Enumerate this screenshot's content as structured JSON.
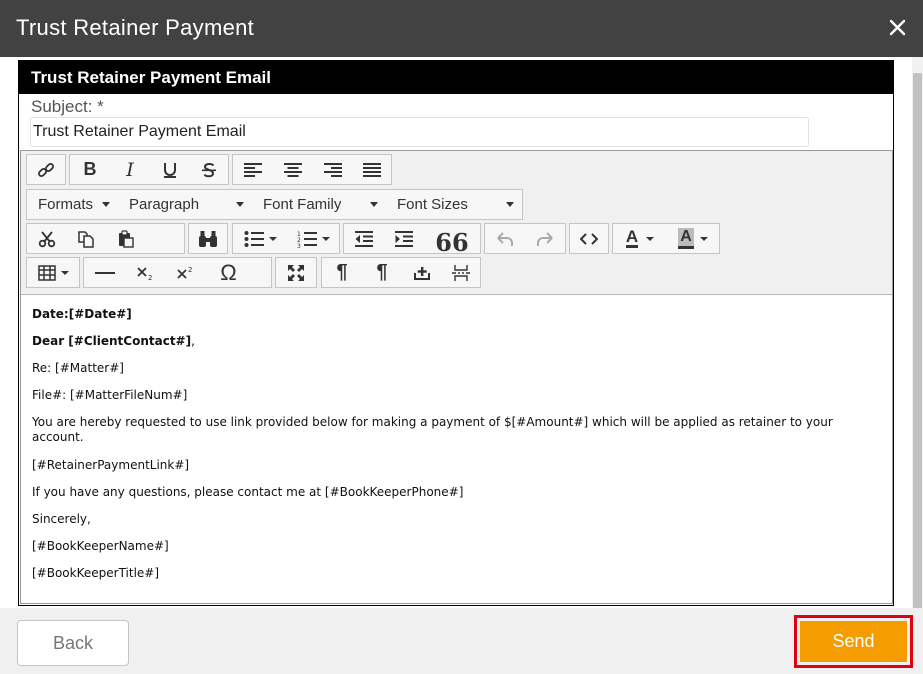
{
  "dialog": {
    "title": "Trust Retainer Payment",
    "close_icon": "close-icon"
  },
  "panel": {
    "header": "Trust Retainer Payment Email",
    "subject_label": "Subject: *",
    "subject_value": "Trust Retainer Payment Email"
  },
  "toolbar": {
    "row1_icons": [
      "link-icon",
      "bold-icon",
      "italic-icon",
      "underline-icon",
      "strikethrough-icon",
      "align-left-icon",
      "align-center-icon",
      "align-right-icon",
      "align-justify-icon"
    ],
    "formats_label": "Formats",
    "paragraph_label": "Paragraph",
    "font_family_label": "Font Family",
    "font_sizes_label": "Font Sizes",
    "row3_icons": [
      "cut-icon",
      "copy-icon",
      "paste-icon",
      "find-icon",
      "bullet-list-icon",
      "numbered-list-icon",
      "outdent-icon",
      "indent-icon",
      "blockquote-icon",
      "undo-icon",
      "redo-icon",
      "code-icon",
      "text-color-icon",
      "background-color-icon"
    ],
    "row4_icons": [
      "table-icon",
      "horizontal-rule-icon",
      "subscript-icon",
      "superscript-icon",
      "special-char-icon",
      "fullscreen-icon",
      "ltr-icon",
      "rtl-icon",
      "insert-icon",
      "page-break-icon"
    ],
    "text_color_glyph": "A",
    "bg_color_glyph": "A",
    "omega_glyph": "Ω",
    "quote_glyph": "66",
    "pilcrow_glyph": "¶"
  },
  "email_body": {
    "date_line": "Date:[#Date#]",
    "dear_prefix": "Dear [#ClientContact#]",
    "dear_suffix": ",",
    "re_line": "Re: [#Matter#]",
    "file_line": "File#: [#MatterFileNum#]",
    "request_line": "You are hereby requested to use link provided below for making a payment of $[#Amount#] which will be applied as retainer to your account.",
    "link_line": "[#RetainerPaymentLink#]",
    "questions_line": "If you have any questions, please contact me at [#BookKeeperPhone#]",
    "closing_line": "Sincerely,",
    "name_line": "[#BookKeeperName#]",
    "title_line": "[#BookKeeperTitle#]"
  },
  "footer": {
    "back_label": "Back",
    "send_label": "Send"
  },
  "colors": {
    "titlebar": "#424242",
    "send_button": "#f59c00",
    "send_highlight": "#e0000f"
  }
}
